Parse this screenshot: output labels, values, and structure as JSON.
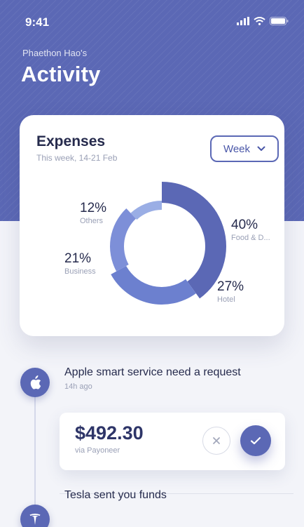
{
  "status_bar": {
    "time": "9:41"
  },
  "header": {
    "subtitle": "Phaethon Hao's",
    "title": "Activity"
  },
  "expenses": {
    "title": "Expenses",
    "subtitle": "This week, 14-21 Feb",
    "period_button": "Week",
    "segments": [
      {
        "percent": "40%",
        "name": "Food & D...",
        "value": 40,
        "color": "#5b68b5"
      },
      {
        "percent": "27%",
        "name": "Hotel",
        "value": 27,
        "color": "#6c80cf"
      },
      {
        "percent": "21%",
        "name": "Business",
        "value": 21,
        "color": "#7d8fd8"
      },
      {
        "percent": "12%",
        "name": "Others",
        "value": 12,
        "color": "#9aaee5"
      }
    ]
  },
  "activities": [
    {
      "icon": "apple-icon",
      "title": "Apple smart service need a request",
      "time": "14h ago"
    },
    {
      "icon": "tesla-icon",
      "title": "Tesla sent you funds",
      "time": ""
    }
  ],
  "payment": {
    "amount": "$492.30",
    "via": "via Payoneer"
  },
  "colors": {
    "primary": "#5b68b5",
    "background": "#f3f4f9",
    "card": "#ffffff"
  }
}
